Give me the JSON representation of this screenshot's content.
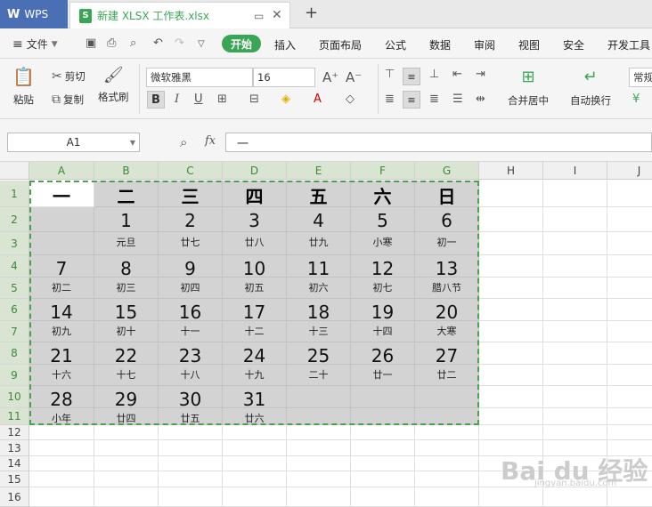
{
  "app": {
    "name": "WPS",
    "doc_title": "新建 XLSX 工作表.xlsx"
  },
  "menu": {
    "file_label": "文件",
    "active_tab": "开始",
    "tabs": [
      "插入",
      "页面布局",
      "公式",
      "数据",
      "审阅",
      "视图",
      "安全",
      "开发工具"
    ]
  },
  "ribbon": {
    "paste": "粘贴",
    "cut": "剪切",
    "copy": "复制",
    "format_painter": "格式刷",
    "font_name": "微软雅黑",
    "font_size": "16",
    "merge_center": "合并居中",
    "wrap_text": "自动换行",
    "number_format": "常规"
  },
  "formula": {
    "cell_ref": "A1",
    "fx": "fx",
    "value": "一"
  },
  "columns": [
    "A",
    "B",
    "C",
    "D",
    "E",
    "F",
    "G",
    "H",
    "I",
    "J"
  ],
  "rows": [
    "1",
    "2",
    "3",
    "4",
    "5",
    "6",
    "7",
    "8",
    "9",
    "10",
    "11",
    "12",
    "13",
    "14",
    "15",
    "16"
  ],
  "calendar": {
    "weekdays": [
      "一",
      "二",
      "三",
      "四",
      "五",
      "六",
      "日"
    ],
    "weeks": [
      {
        "days": [
          "",
          "1",
          "2",
          "3",
          "4",
          "5",
          "6"
        ],
        "lunar": [
          "",
          "元旦",
          "廿七",
          "廿八",
          "廿九",
          "小寒",
          "初一"
        ]
      },
      {
        "days": [
          "7",
          "8",
          "9",
          "10",
          "11",
          "12",
          "13"
        ],
        "lunar": [
          "初二",
          "初三",
          "初四",
          "初五",
          "初六",
          "初七",
          "腊八节"
        ]
      },
      {
        "days": [
          "14",
          "15",
          "16",
          "17",
          "18",
          "19",
          "20"
        ],
        "lunar": [
          "初九",
          "初十",
          "十一",
          "十二",
          "十三",
          "十四",
          "大寒"
        ]
      },
      {
        "days": [
          "21",
          "22",
          "23",
          "24",
          "25",
          "26",
          "27"
        ],
        "lunar": [
          "十六",
          "十七",
          "十八",
          "十九",
          "二十",
          "廿一",
          "廿二"
        ]
      },
      {
        "days": [
          "28",
          "29",
          "30",
          "31",
          "",
          "",
          ""
        ],
        "lunar": [
          "小年",
          "廿四",
          "廿五",
          "廿六",
          "",
          "",
          ""
        ]
      }
    ]
  },
  "watermark": {
    "text": "Bai du 经验",
    "url": "jingyan.baidu.com"
  },
  "colors": {
    "accent": "#3aa655",
    "wps_blue": "#4a6fb5",
    "cell_shade": "#d3d3d3"
  }
}
